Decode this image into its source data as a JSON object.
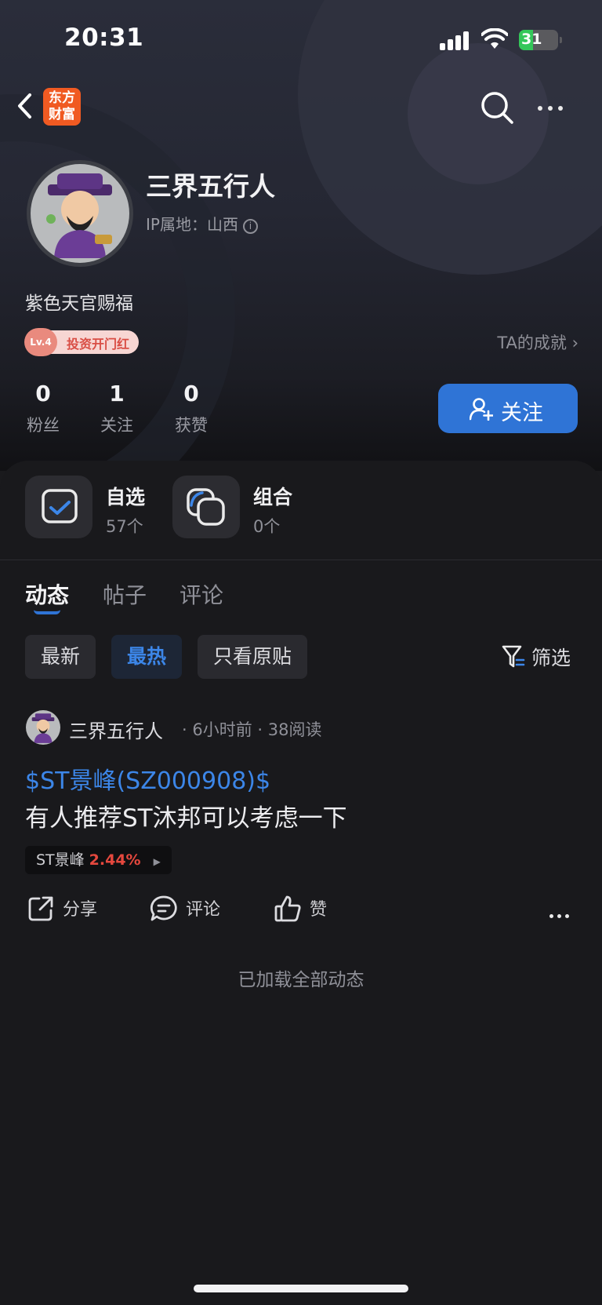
{
  "status_bar": {
    "time": "20:31",
    "battery": "31"
  },
  "nav": {
    "logo_text": "东方财富"
  },
  "profile": {
    "name": "三界五行人",
    "ip_location": "IP属地：山西",
    "bio": "紫色天官赐福",
    "badge_level": "Lv.4",
    "badge_text": "投资开门红",
    "achievement_link": "TA的成就 ›",
    "stats": [
      {
        "value": "0",
        "label": "粉丝"
      },
      {
        "value": "1",
        "label": "关注"
      },
      {
        "value": "0",
        "label": "获赞"
      }
    ],
    "follow_label": "关注"
  },
  "shortcuts": [
    {
      "title": "自选",
      "count": "57个"
    },
    {
      "title": "组合",
      "count": "0个"
    }
  ],
  "tabs": [
    {
      "label": "动态",
      "active": true
    },
    {
      "label": "帖子",
      "active": false
    },
    {
      "label": "评论",
      "active": false
    }
  ],
  "filters": {
    "chips": [
      {
        "label": "最新",
        "active": false
      },
      {
        "label": "最热",
        "active": true
      },
      {
        "label": "只看原贴",
        "active": false
      }
    ],
    "filter_label": "筛选"
  },
  "post": {
    "author": "三界五行人",
    "meta": "· 6小时前 · 38阅读",
    "tag": "$ST景峰(SZ000908)$",
    "text": "有人推荐ST沐邦可以考虑一下",
    "stock_name": "ST景峰",
    "stock_change": "2.44%",
    "actions": {
      "share": "分享",
      "comment": "评论",
      "like": "赞"
    }
  },
  "footer_text": "已加载全部动态",
  "colors": {
    "accent": "#2f74d6",
    "link": "#3c86e8",
    "up": "#e5483e",
    "logo": "#f05a22"
  }
}
